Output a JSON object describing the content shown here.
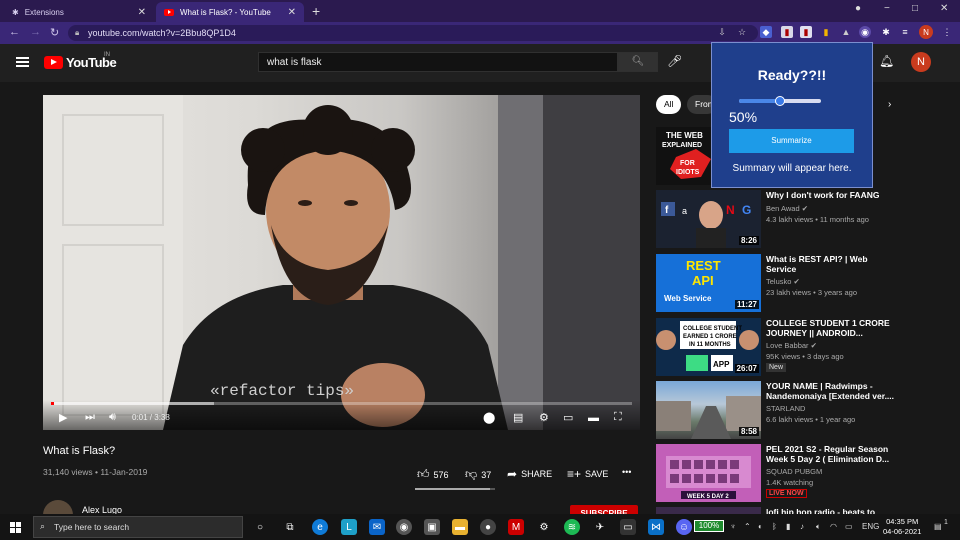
{
  "browser": {
    "tabs": [
      {
        "label": "Extensions",
        "active": false
      },
      {
        "label": "What is Flask? - YouTube",
        "active": true
      }
    ],
    "url": "youtube.com/watch?v=2Bbu8QP1D4",
    "profile_initial": "N",
    "window_controls": [
      "−",
      "□",
      "✕"
    ]
  },
  "youtube": {
    "logo_text": "YouTube",
    "country": "IN",
    "search_value": "what is flask",
    "avatar_initial": "N",
    "chips": [
      "All",
      "From"
    ],
    "player": {
      "overlay_text": "«refactor tips»",
      "time": "0:01 / 3:38",
      "progress_fraction": 0.005,
      "buffer_fraction": 0.28
    },
    "video": {
      "title": "What is Flask?",
      "meta": "31,140 views • 11-Jan-2019",
      "likes": "576",
      "dislikes": "37",
      "share_label": "SHARE",
      "save_label": "SAVE",
      "more_label": "•••",
      "like_fraction": 0.94,
      "channel": "Alex Lugo",
      "subscribe_label": "SUBSCRIBE"
    },
    "recommendations": [
      {
        "title": "",
        "channel": "",
        "meta": "",
        "duration": "",
        "thumb_text": "THE WEB EXPLAINED FOR IDIOTS"
      },
      {
        "title": "Why I don't work for FAANG",
        "channel": "Ben Awad ✔",
        "meta": "4.3 lakh views • 11 months ago",
        "duration": "8:26",
        "thumb_text": "f a N G"
      },
      {
        "title": "What is REST API? | Web Service",
        "channel": "Telusko ✔",
        "meta": "23 lakh views • 3 years ago",
        "duration": "11:27",
        "thumb_text": "REST API Web Service"
      },
      {
        "title": "COLLEGE STUDENT 1 CRORE JOURNEY || ANDROID...",
        "channel": "Love Babbar ✔",
        "meta": "95K views • 3 days ago",
        "duration": "26:07",
        "badge": "New",
        "thumb_text": "COLLEGE STUDENT EARNED 1 CRORE IN 11 MONTHS"
      },
      {
        "title": "YOUR NAME | Radwimps - Nandemonaiya [Extended ver....",
        "channel": "STARLAND",
        "meta": "6.6 lakh views • 1 year ago",
        "duration": "8:58",
        "thumb_text": ""
      },
      {
        "title": "PEL 2021 S2 - Regular Season Week 5 Day 2 ( Elimination D...",
        "channel": "SQUAD PUBGM",
        "meta": "1.4K watching",
        "duration": "",
        "badge_live": "LIVE NOW",
        "thumb_text": "WEEK 5 DAY 2"
      },
      {
        "title": "lofi hip hop radio - beats to",
        "channel": "",
        "meta": "",
        "duration": "",
        "thumb_text": ""
      }
    ]
  },
  "extension_popup": {
    "title": "Ready??!!",
    "slider_value": 0.5,
    "percent_label": "50%",
    "button_label": "Summarize",
    "summary_text": "Summary will appear here."
  },
  "taskbar": {
    "search_placeholder": "Type here to search",
    "battery": "100%",
    "language": "ENG",
    "time": "04:35 PM",
    "date": "04-06-2021",
    "notification_count": "1"
  },
  "colors": {
    "accent": "#ff0000",
    "tab_bar": "#2b1a4f",
    "toolbar": "#3a2777",
    "popup_bg": "#1f3f8c",
    "popup_button": "#1d9be8"
  }
}
